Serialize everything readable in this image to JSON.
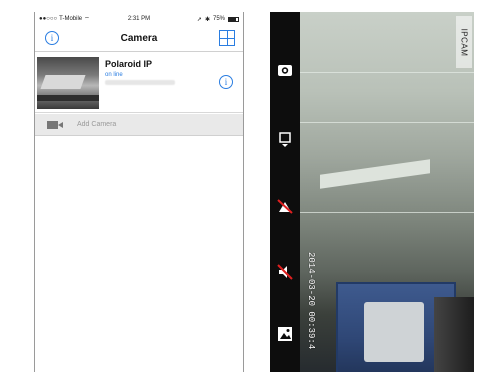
{
  "left_screen": {
    "status_bar": {
      "carrier": "T-Mobile",
      "time": "2:31 PM",
      "battery": "75%"
    },
    "nav": {
      "title": "Camera",
      "info_icon": "info-icon",
      "grid_icon": "grid-icon"
    },
    "camera_list": [
      {
        "name": "Polaroid IP",
        "status": "on line"
      }
    ],
    "add_camera_label": "Add Camera"
  },
  "right_screen": {
    "overlay_label": "IPCAM",
    "timestamp": "2014-03-20 00:39:4",
    "toolbar_icons": [
      "snapshot-camera-icon",
      "record-icon",
      "mute-icon",
      "speaker-off-icon",
      "album-icon"
    ]
  },
  "colors": {
    "accent": "#2a7de1",
    "status_text": "#2a7de1",
    "add_row_bg": "#e9e9e9"
  }
}
